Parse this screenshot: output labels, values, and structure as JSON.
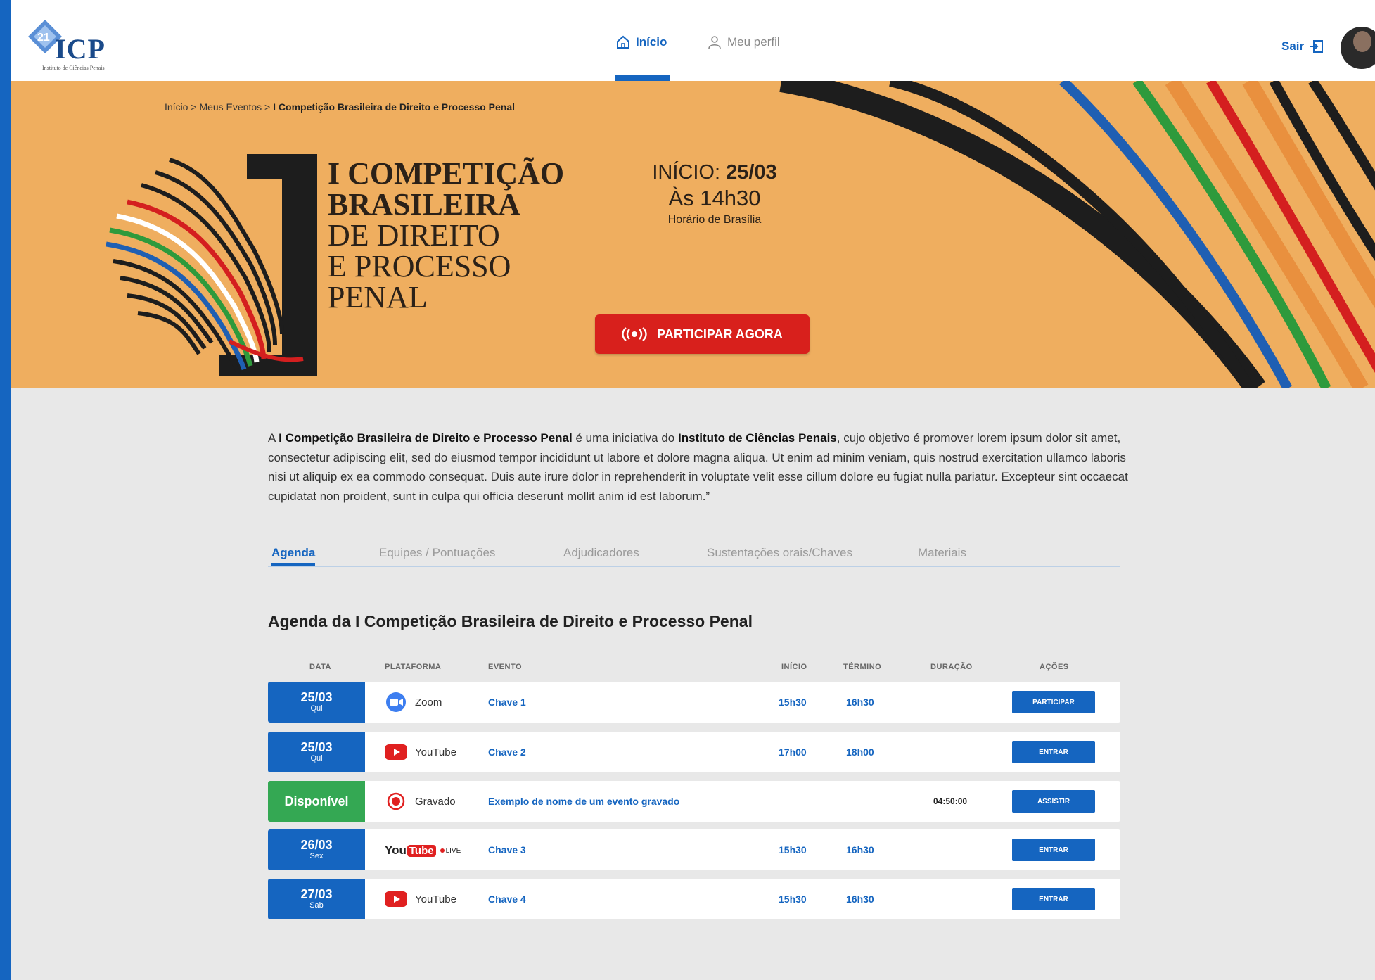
{
  "brand": {
    "logo_badge": "21",
    "logo_name": "ICP",
    "logo_sub": "Instituto de Ciências Penais",
    "primary_color": "#1565c0",
    "banner_color": "#efae5f",
    "accent_red": "#d8201c",
    "available_green": "#34a853"
  },
  "nav": {
    "home_label": "Início",
    "profile_label": "Meu perfil",
    "logout_label": "Sair"
  },
  "breadcrumb": {
    "home": "Início",
    "sep1": " > ",
    "events": "Meus Eventos",
    "sep2": " > ",
    "current": "I Competição Brasileira de Direito e Processo Penal"
  },
  "banner": {
    "title_lines_bold": [
      "I COMPETIÇÃO",
      "BRASILEIRA"
    ],
    "title_lines_normal": [
      "DE DIREITO",
      "E PROCESSO",
      "PENAL"
    ],
    "start_label": "INÍCIO: ",
    "start_date": "25/03",
    "start_time": "Às 14h30",
    "timezone": "Horário de Brasília",
    "join_button": "PARTICIPAR AGORA"
  },
  "description": {
    "p1": "A ",
    "b1": "I Competição Brasileira de Direito e Processo Penal",
    "p2": " é uma iniciativa do ",
    "b2": "Instituto de Ciências Penais",
    "p3": ", cujo objetivo é promover lorem ipsum dolor sit amet, consectetur adipiscing elit, sed do eiusmod tempor incididunt ut labore et dolore magna aliqua. Ut enim ad minim veniam, quis nostrud exercitation ullamco laboris nisi ut aliquip ex ea commodo consequat. Duis aute irure dolor in reprehenderit in voluptate velit esse cillum dolore eu fugiat nulla pariatur. Excepteur sint occaecat cupidatat non proident, sunt in culpa qui officia deserunt mollit anim id est laborum.”"
  },
  "tabs": [
    "Agenda",
    "Equipes / Pontuações",
    "Adjudicadores",
    "Sustentações orais/Chaves",
    "Materiais"
  ],
  "agenda": {
    "title": "Agenda da I Competição Brasileira de Direito e Processo Penal",
    "headers": {
      "date": "DATA",
      "platform": "PLATAFORMA",
      "event": "EVENTO",
      "start": "INÍCIO",
      "end": "TÉRMINO",
      "duration": "DURAÇÃO",
      "actions": "AÇÕES"
    },
    "rows": [
      {
        "date": "25/03",
        "weekday": "Qui",
        "platform": "Zoom",
        "event": "Chave 1",
        "start": "15h30",
        "end": "16h30",
        "duration": "",
        "action": "PARTICIPAR"
      },
      {
        "date": "25/03",
        "weekday": "Qui",
        "platform": "YouTube",
        "event": "Chave 2",
        "start": "17h00",
        "end": "18h00",
        "duration": "",
        "action": "ENTRAR"
      },
      {
        "date": "Disponível",
        "weekday": "",
        "platform": "Gravado",
        "event": "Exemplo de nome de um evento gravado",
        "start": "",
        "end": "",
        "duration": "04:50:00",
        "action": "ASSISTIR"
      },
      {
        "date": "26/03",
        "weekday": "Sex",
        "platform_you": "You",
        "platform_tube": "Tube",
        "platform_live": "LIVE",
        "event": "Chave 3",
        "start": "15h30",
        "end": "16h30",
        "duration": "",
        "action": "ENTRAR"
      },
      {
        "date": "27/03",
        "weekday": "Sab",
        "platform": "YouTube",
        "event": "Chave 4",
        "start": "15h30",
        "end": "16h30",
        "duration": "",
        "action": "ENTRAR"
      }
    ]
  }
}
